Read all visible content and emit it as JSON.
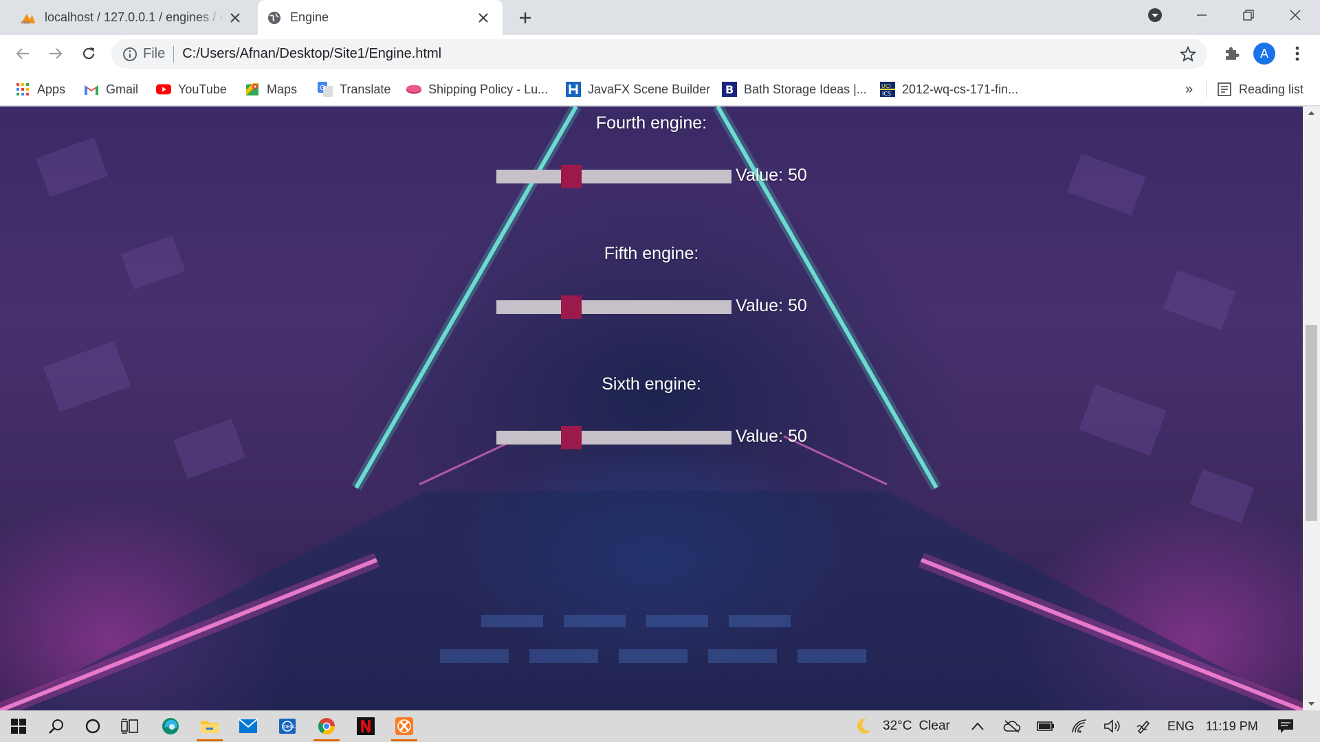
{
  "browser": {
    "tabs": [
      {
        "title": "localhost / 127.0.0.1 / engines / e",
        "icon": "phpmyadmin-icon",
        "active": false
      },
      {
        "title": "Engine",
        "icon": "globe-icon",
        "active": true
      }
    ],
    "address": {
      "scheme_label": "File",
      "url": "C:/Users/Afnan/Desktop/Site1/Engine.html"
    },
    "profile_initial": "A",
    "bookmarks": [
      {
        "label": "Apps",
        "icon": "apps-grid-icon"
      },
      {
        "label": "Gmail",
        "icon": "gmail-icon"
      },
      {
        "label": "YouTube",
        "icon": "youtube-icon"
      },
      {
        "label": "Maps",
        "icon": "maps-icon"
      },
      {
        "label": "Translate",
        "icon": "translate-icon"
      },
      {
        "label": "Shipping Policy - Lu...",
        "icon": "pill-icon"
      },
      {
        "label": "JavaFX Scene Builder",
        "icon": "h-letter-icon"
      },
      {
        "label": "Bath Storage Ideas |...",
        "icon": "b-letter-icon"
      },
      {
        "label": "2012-wq-cs-171-fin...",
        "icon": "uci-icon"
      }
    ],
    "overflow_label": "»",
    "reading_list": "Reading list"
  },
  "engines": [
    {
      "label": "Fourth engine:",
      "value_text": "Value: 50",
      "value": 50
    },
    {
      "label": "Fifth engine:",
      "value_text": "Value: 50",
      "value": 50
    },
    {
      "label": "Sixth engine:",
      "value_text": "Value: 50",
      "value": 50
    }
  ],
  "colors": {
    "slider_track": "#c6c0c9",
    "slider_thumb": "#9c1a4b",
    "accent": "#1a73e8"
  },
  "taskbar": {
    "weather_temp": "32°C",
    "weather_condition": "Clear",
    "language": "ENG",
    "time": "11:19 PM"
  }
}
